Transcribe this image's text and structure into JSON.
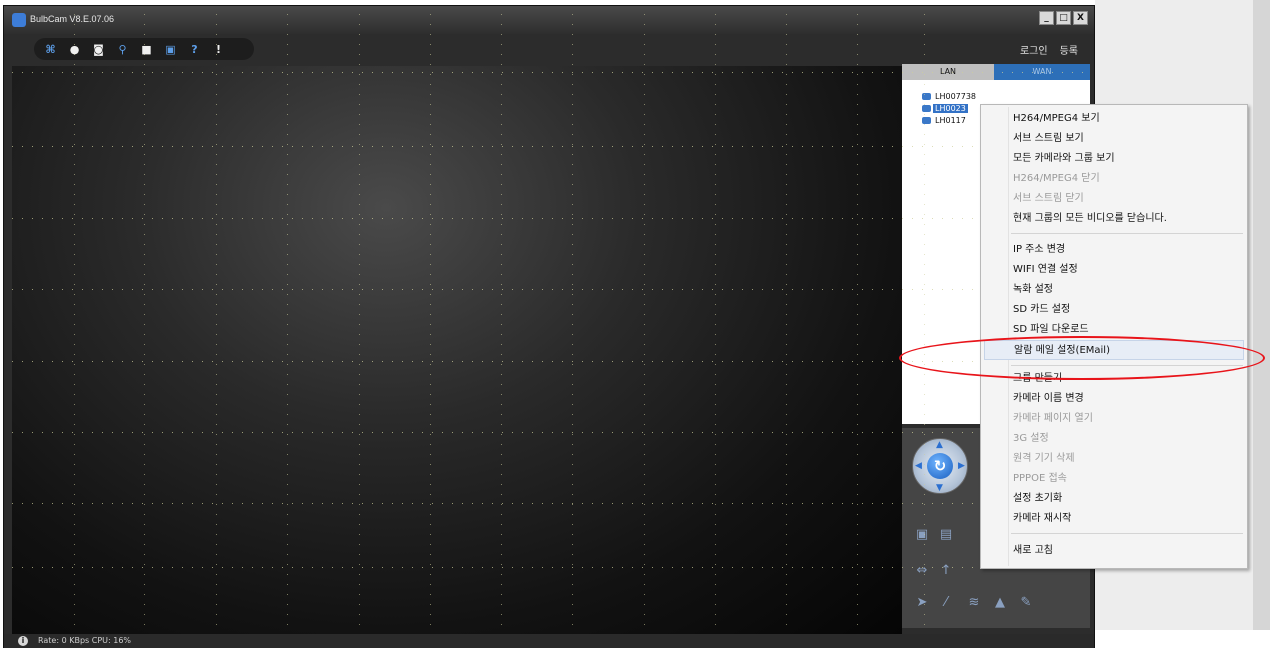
{
  "window": {
    "title": "BulbCam  V8.E.07.06",
    "controls": [
      "_",
      "□",
      "X"
    ]
  },
  "toolbar": {
    "icons": [
      "network-icon",
      "settings-icon",
      "camera-icon",
      "search-icon",
      "lock-icon",
      "save-icon",
      "help-icon",
      "info-icon"
    ],
    "glyphs": [
      "⌘",
      "●",
      "◙",
      "⚲",
      "🔒",
      "▣",
      "?",
      "!"
    ]
  },
  "account": {
    "login": "로그인",
    "register": "등록"
  },
  "tabs": {
    "lan": "LAN",
    "wan": "WAN"
  },
  "devices": [
    {
      "label": "LH007738",
      "selected": false
    },
    {
      "label": "LH0023",
      "selected": true
    },
    {
      "label": "LH0117",
      "selected": false
    }
  ],
  "context_menu": {
    "group1": [
      {
        "label": "H264/MPEG4 보기",
        "enabled": true
      },
      {
        "label": "서브 스트림 보기",
        "enabled": true
      },
      {
        "label": "모든 카메라와 그룹 보기",
        "enabled": true
      },
      {
        "label": "H264/MPEG4 닫기",
        "enabled": false
      },
      {
        "label": "서브 스트림 닫기",
        "enabled": false
      },
      {
        "label": "현재 그룹의 모든 비디오를 닫습니다.",
        "enabled": true
      }
    ],
    "group2": [
      {
        "label": "IP 주소 변경",
        "enabled": true
      },
      {
        "label": "WIFI 연결 설정",
        "enabled": true
      },
      {
        "label": "녹화 설정",
        "enabled": true
      },
      {
        "label": "SD 카드 설정",
        "enabled": true
      },
      {
        "label": "SD 파일 다운로드",
        "enabled": true
      },
      {
        "label": "알람 메일 설정(EMail)",
        "enabled": true,
        "highlighted": true
      }
    ],
    "group3": [
      {
        "label": "그룹 만들기",
        "enabled": true
      },
      {
        "label": "카메라 이름 변경",
        "enabled": true
      },
      {
        "label": "카메라 페이지 열기",
        "enabled": false
      },
      {
        "label": "3G 설정",
        "enabled": false
      },
      {
        "label": "원격 기기 삭제",
        "enabled": false
      },
      {
        "label": "PPPOE 접속",
        "enabled": false
      },
      {
        "label": "설정 초기화",
        "enabled": true
      },
      {
        "label": "카메라 재시작",
        "enabled": true
      }
    ],
    "group4": [
      {
        "label": "새로 고침",
        "enabled": true
      }
    ]
  },
  "status": {
    "text": "Rate: 0 KBps  CPU:  16%"
  },
  "colors": {
    "accent": "#2d6fb8",
    "annotation": "#e8141a",
    "selection": "#3372c6"
  }
}
